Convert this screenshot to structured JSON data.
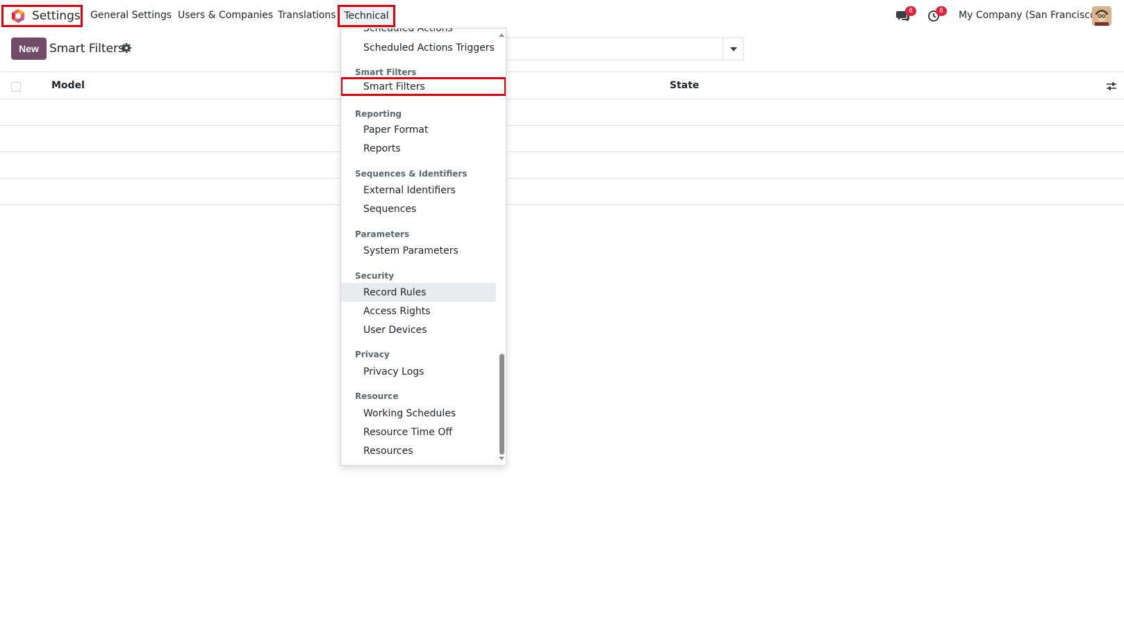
{
  "navbar": {
    "app_title": "Settings",
    "menu": {
      "general_settings": "General Settings",
      "users_companies": "Users & Companies",
      "translations": "Translations",
      "technical": "Technical"
    },
    "messages_badge": "8",
    "activities_badge": "8",
    "company": "My Company (San Francisco)"
  },
  "control_panel": {
    "new_button": "New",
    "title": "Smart Filters",
    "search_placeholder": ""
  },
  "table": {
    "columns": [
      "Model",
      "State"
    ]
  },
  "dropdown": {
    "items_top": {
      "scheduled_actions": "Scheduled Actions",
      "scheduled_actions_triggers": "Scheduled Actions Triggers"
    },
    "sections": {
      "smart_filters": {
        "header": "Smart Filters",
        "items": [
          "Smart Filters"
        ]
      },
      "reporting": {
        "header": "Reporting",
        "items": [
          "Paper Format",
          "Reports"
        ]
      },
      "sequences": {
        "header": "Sequences & Identifiers",
        "items": [
          "External Identifiers",
          "Sequences"
        ]
      },
      "parameters": {
        "header": "Parameters",
        "items": [
          "System Parameters"
        ]
      },
      "security": {
        "header": "Security",
        "items": [
          "Record Rules",
          "Access Rights",
          "User Devices"
        ]
      },
      "privacy": {
        "header": "Privacy",
        "items": [
          "Privacy Logs"
        ]
      },
      "resource": {
        "header": "Resource",
        "items": [
          "Working Schedules",
          "Resource Time Off",
          "Resources"
        ]
      }
    }
  },
  "colors": {
    "brand": "#714b67",
    "highlight": "#e0000b",
    "badge": "#e0233a"
  }
}
